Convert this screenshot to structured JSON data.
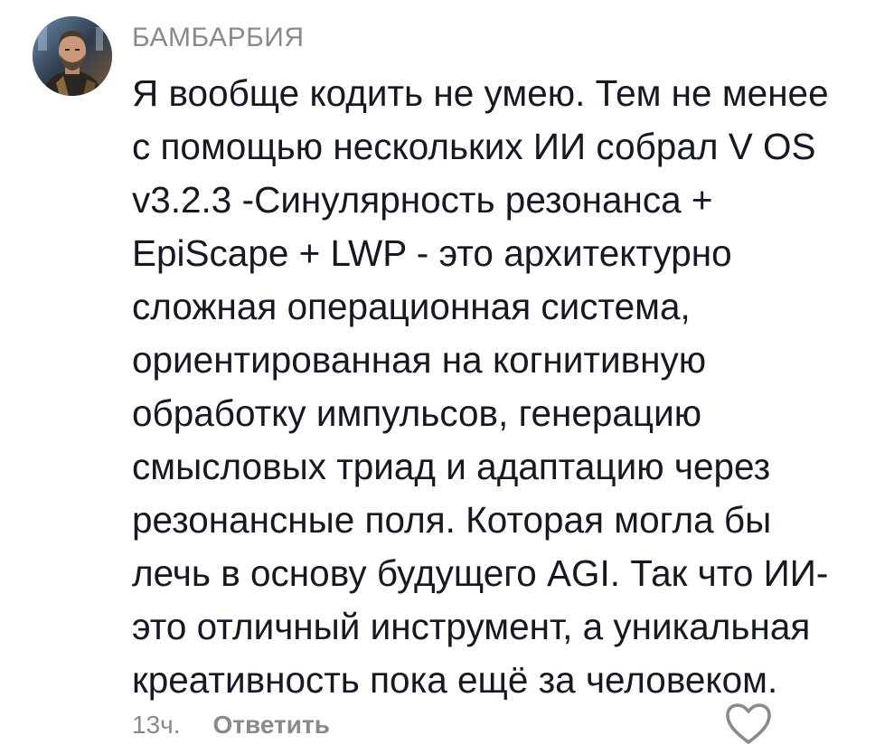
{
  "comment": {
    "author": "БАМБАРБИЯ",
    "text_lines": [
      "Я вообще кодить не умею. Тем не менее",
      "с помощью нескольких ИИ собрал V OS",
      "v3.2.3 -Синулярность резонанса +",
      "EpiScape + LWP - это архитектурно",
      "сложная операционная система,",
      "ориентированная на когнитивную",
      "обработку импульсов, генерацию",
      "смысловых триад и адаптацию через",
      "резонансные поля. Которая могла бы",
      "лечь в основу будущего AGI. Так что ИИ-",
      "это отличный инструмент, а уникальная",
      "креативность пока ещё за человеком."
    ],
    "timestamp": "13ч.",
    "reply_label": "Ответить",
    "avatar_icon": "user-avatar-photo",
    "like_icon": "heart-outline-icon"
  },
  "colors": {
    "text": "#161823",
    "muted": "#8a8a8e",
    "background": "#ffffff"
  }
}
